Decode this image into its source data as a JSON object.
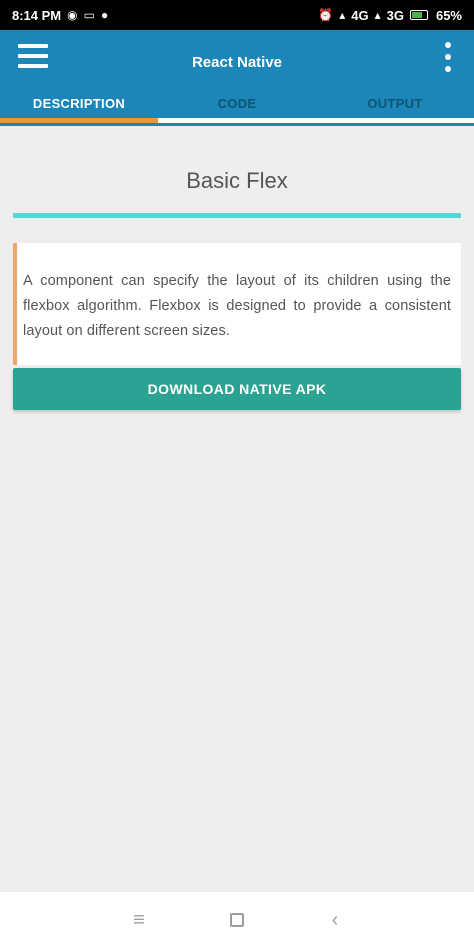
{
  "status_bar": {
    "time": "8:14 PM",
    "signal_text": "4G",
    "network_text": "3G",
    "battery": "65%"
  },
  "app_bar": {
    "title": "React Native",
    "menu_icon": "hamburger-menu-icon",
    "overflow_icon": "more-vert-icon"
  },
  "tabs": [
    {
      "label": "DESCRIPTION",
      "active": true
    },
    {
      "label": "CODE",
      "active": false
    },
    {
      "label": "OUTPUT",
      "active": false
    }
  ],
  "content": {
    "title": "Basic Flex",
    "description": "A component can specify the layout of its children using the flexbox algorithm. Flexbox is designed to provide a consistent layout on different screen sizes.",
    "download_label": "DOWNLOAD NATIVE APK"
  },
  "nav_bar": {
    "recent_icon": "recent-apps-icon",
    "home_icon": "home-icon",
    "back_icon": "back-icon"
  },
  "colors": {
    "app_bar": "#1c86b8",
    "tab_indicator": "#e39a3c",
    "title_rule": "#56d6d6",
    "card_accent": "#f0a766",
    "download_button": "#2aa393",
    "background": "#eeeeee"
  }
}
